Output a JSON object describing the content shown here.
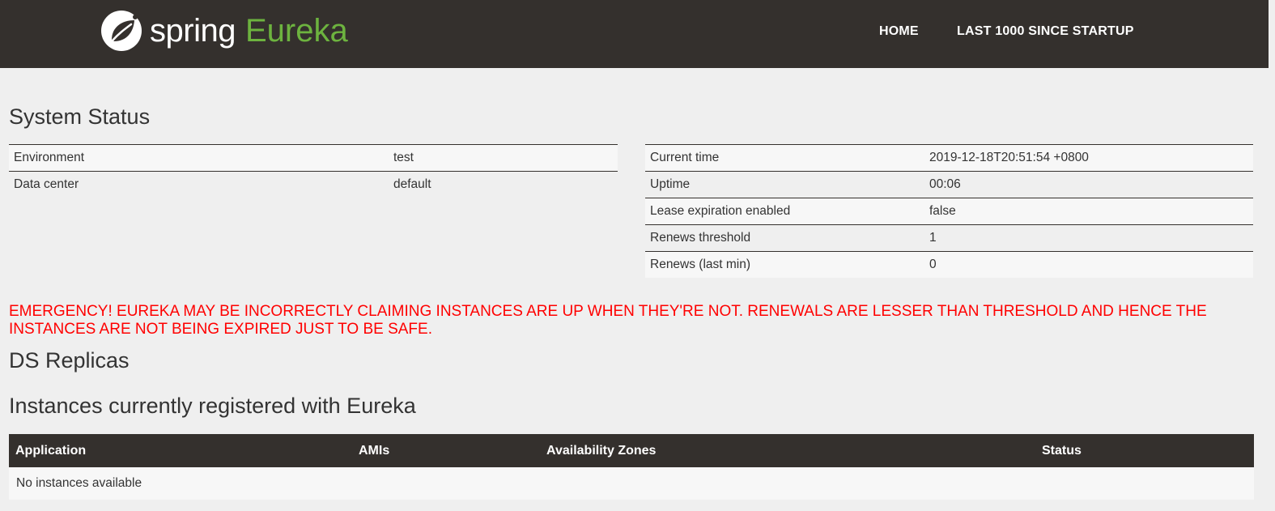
{
  "brand": {
    "logo_icon": "spring-leaf-icon",
    "spring": "spring",
    "eureka": "Eureka",
    "colors": {
      "header_bg": "#34302d",
      "accent": "#6db33f",
      "emergency": "#ff0000"
    }
  },
  "nav": {
    "home": "HOME",
    "last_1000": "LAST 1000 SINCE STARTUP"
  },
  "system_status": {
    "title": "System Status",
    "left": [
      {
        "key": "Environment",
        "value": "test"
      },
      {
        "key": "Data center",
        "value": "default"
      }
    ],
    "right": [
      {
        "key": "Current time",
        "value": "2019-12-18T20:51:54 +0800"
      },
      {
        "key": "Uptime",
        "value": "00:06"
      },
      {
        "key": "Lease expiration enabled",
        "value": "false"
      },
      {
        "key": "Renews threshold",
        "value": "1"
      },
      {
        "key": "Renews (last min)",
        "value": "0"
      }
    ]
  },
  "emergency": "EMERGENCY! EUREKA MAY BE INCORRECTLY CLAIMING INSTANCES ARE UP WHEN THEY'RE NOT. RENEWALS ARE LESSER THAN THRESHOLD AND HENCE THE INSTANCES ARE NOT BEING EXPIRED JUST TO BE SAFE.",
  "ds_replicas": {
    "title": "DS Replicas"
  },
  "instances": {
    "title": "Instances currently registered with Eureka",
    "columns": [
      "Application",
      "AMIs",
      "Availability Zones",
      "Status"
    ],
    "empty_message": "No instances available"
  }
}
